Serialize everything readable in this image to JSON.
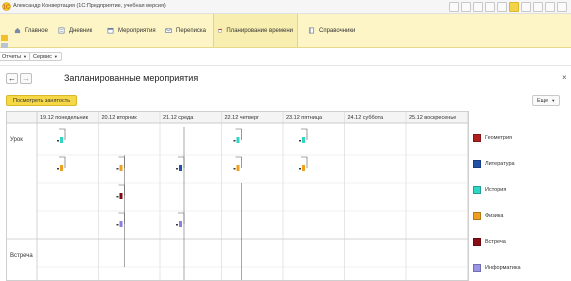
{
  "window": {
    "title": "Александр Конвертация (1С:Предприятие, учебная версия)"
  },
  "sections": [
    {
      "label": "Главное",
      "icon": "home-icon",
      "active": false
    },
    {
      "label": "Дневник",
      "icon": "diary-icon",
      "active": false
    },
    {
      "label": "Мероприятия",
      "icon": "events-icon",
      "active": false
    },
    {
      "label": "Переписка",
      "icon": "mail-icon",
      "active": false
    },
    {
      "label": "Планирование времени",
      "icon": "calendar-icon",
      "active": true
    },
    {
      "label": "Справочники",
      "icon": "book-icon",
      "active": false
    }
  ],
  "actionbar": {
    "reports_label": "Отчеты",
    "service_label": "Сервис"
  },
  "form": {
    "title": "Запланированные мероприятия",
    "show_busy_label": "Посмотреть занятость",
    "more_label": "Еще",
    "back": "←",
    "forward": "→",
    "close": "×"
  },
  "planner": {
    "days": [
      "19.12 понедельник",
      "20.12 вторник",
      "21.12 среда",
      "22.12 четверг",
      "23.12 пятница",
      "24.12 суббота",
      "25.12 воскресенье"
    ],
    "rows": [
      "Урок",
      "Встреча"
    ],
    "items": [
      {
        "day": 0,
        "slot": 0,
        "color": "#2fd6c4"
      },
      {
        "day": 0,
        "slot": 1,
        "color": "#f0a020"
      },
      {
        "day": 1,
        "slot": 1,
        "color": "#f0a020"
      },
      {
        "day": 1,
        "slot": 2,
        "color": "#7a0b12"
      },
      {
        "day": 1,
        "slot": 3,
        "color": "#8a7fe0"
      },
      {
        "day": 2,
        "slot": 1,
        "color": "#2050a8"
      },
      {
        "day": 2,
        "slot": 3,
        "color": "#8a7fe0"
      },
      {
        "day": 3,
        "slot": 0,
        "color": "#2fd6c4"
      },
      {
        "day": 3,
        "slot": 1,
        "color": "#f0a020"
      },
      {
        "day": 4,
        "slot": 0,
        "color": "#2fd6c4"
      },
      {
        "day": 4,
        "slot": 1,
        "color": "#f0a020"
      }
    ]
  },
  "legend": [
    {
      "label": "Геометрия",
      "color": "#b01e1e"
    },
    {
      "label": "Литература",
      "color": "#2050a8"
    },
    {
      "label": "История",
      "color": "#2fd6c4"
    },
    {
      "label": "Физика",
      "color": "#f0a020"
    },
    {
      "label": "Встреча",
      "color": "#8a0d15"
    },
    {
      "label": "Информатика",
      "color": "#9a95e8"
    }
  ]
}
